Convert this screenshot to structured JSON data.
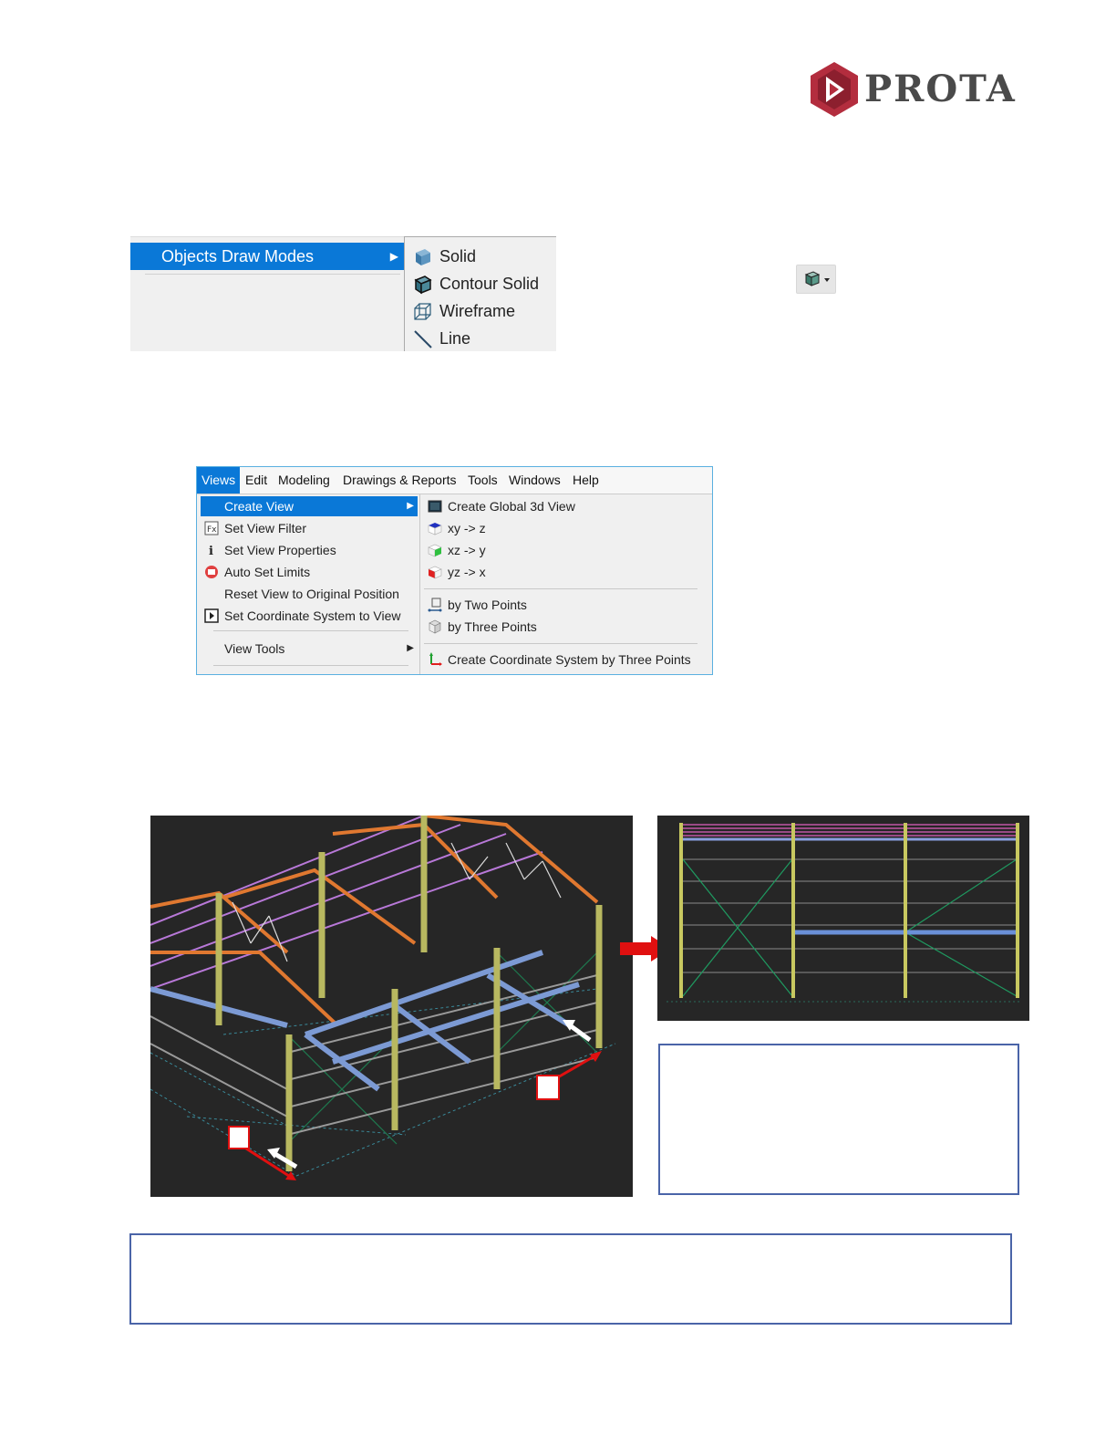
{
  "logo": {
    "text": "PROTA",
    "brand_color": "#b32d3e"
  },
  "draw_modes_menu": {
    "parent_label": "Objects Draw Modes",
    "items": [
      {
        "label": "Solid",
        "icon": "solid-cube-icon"
      },
      {
        "label": "Contour Solid",
        "icon": "contour-solid-cube-icon"
      },
      {
        "label": "Wireframe",
        "icon": "wireframe-cube-icon"
      },
      {
        "label": "Line",
        "icon": "line-icon"
      }
    ]
  },
  "toolbar_button": {
    "icon": "draw-mode-dropdown-icon"
  },
  "views_menu": {
    "menubar": [
      "Views",
      "Edit",
      "Modeling",
      "Drawings & Reports",
      "Tools",
      "Windows",
      "Help"
    ],
    "left_items": [
      {
        "label": "Create View",
        "icon": "",
        "has_submenu": true
      },
      {
        "label": "Set View Filter",
        "icon": "filter-icon"
      },
      {
        "label": "Set View Properties",
        "icon": "info-icon"
      },
      {
        "label": "Auto Set Limits",
        "icon": "limits-icon"
      },
      {
        "label": "Reset View to Original Position",
        "icon": ""
      },
      {
        "label": "Set Coordinate System to View",
        "icon": "coordinate-view-icon"
      },
      {
        "label": "View Tools",
        "icon": "",
        "has_submenu": true
      }
    ],
    "right_items": [
      {
        "label": "Create Global 3d View",
        "icon": "global-3d-view-icon"
      },
      {
        "label": "xy -> z",
        "icon": "xy-plane-icon"
      },
      {
        "label": "xz -> y",
        "icon": "xz-plane-icon"
      },
      {
        "label": "yz -> x",
        "icon": "yz-plane-icon"
      },
      {
        "label": "by Two Points",
        "icon": "two-points-icon"
      },
      {
        "label": "by Three Points",
        "icon": "three-points-icon"
      },
      {
        "label": "Create Coordinate System by Three Points",
        "icon": "coordinate-system-icon"
      }
    ]
  },
  "colors": {
    "menu_highlight": "#0a78d7",
    "viewport_bg": "#262626",
    "column": "#b8b860",
    "truss": "#e07830",
    "purlin": "#c080e0",
    "beam": "#7090d0",
    "bracing": "#20a060",
    "arrow_red": "#e01010",
    "box_border": "#4a64a8"
  }
}
